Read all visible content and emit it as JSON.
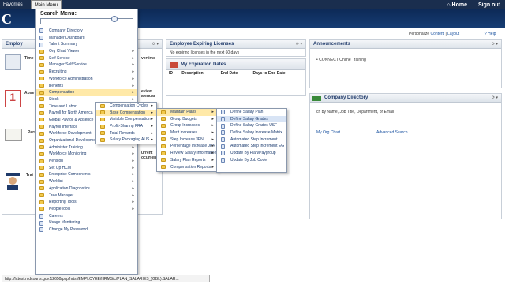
{
  "topbar": {
    "favorites": "Favorites",
    "main_menu": "Main Menu"
  },
  "header": {
    "logo": "C",
    "home": "Home",
    "signout": "Sign out"
  },
  "personalize": {
    "label": "Personalize",
    "content": "Content",
    "sep": "|",
    "layout": "Layout",
    "help": "Help"
  },
  "pagelets": {
    "employee": "Employ",
    "expiring_title": "Employee Expiring Licenses",
    "expiring_msg": "No expiring licenses in the next 60 days",
    "expiration_dates": "My Expiration Dates",
    "exp_cols": [
      "ID",
      "Description",
      "End Date",
      "Days to End Date"
    ],
    "announcements": "Announcements",
    "announce_item": "CONNECT Online Training",
    "company_dir": "Company Directory",
    "dir_hint": "ch by Name, Job Title, Department, or Email",
    "org_chart": "My Org Chart",
    "adv_search": "Advanced Search",
    "time": "Time",
    "absence": "Abse",
    "personal": "Pers",
    "training": "Trai",
    "overtime": "vertime",
    "review": "eview",
    "calendar": "alendar",
    "current": "urrent",
    "documents": "ocuments"
  },
  "menu": {
    "heading": "Search Menu:",
    "items": [
      {
        "label": "Company Directory",
        "type": "page"
      },
      {
        "label": "Manager Dashboard",
        "type": "page"
      },
      {
        "label": "Talent Summary",
        "type": "page"
      },
      {
        "label": "Org Chart Viewer",
        "type": "folder"
      },
      {
        "label": "Self Service",
        "type": "folder"
      },
      {
        "label": "Manager Self Service",
        "type": "folder"
      },
      {
        "label": "Recruiting",
        "type": "folder"
      },
      {
        "label": "Workforce Administration",
        "type": "folder"
      },
      {
        "label": "Benefits",
        "type": "folder"
      },
      {
        "label": "Compensation",
        "type": "folder"
      },
      {
        "label": "Stock",
        "type": "folder"
      },
      {
        "label": "Time and Labor",
        "type": "folder"
      },
      {
        "label": "Payroll for North America",
        "type": "folder"
      },
      {
        "label": "Global Payroll & Absence",
        "type": "folder"
      },
      {
        "label": "Payroll Interface",
        "type": "folder"
      },
      {
        "label": "Workforce Development",
        "type": "folder"
      },
      {
        "label": "Organizational Development",
        "type": "folder"
      },
      {
        "label": "Administer Training",
        "type": "folder"
      },
      {
        "label": "Workforce Monitoring",
        "type": "folder"
      },
      {
        "label": "Pension",
        "type": "folder"
      },
      {
        "label": "Set Up HCM",
        "type": "folder"
      },
      {
        "label": "Enterprise Components",
        "type": "folder"
      },
      {
        "label": "Worklist",
        "type": "folder"
      },
      {
        "label": "Application Diagnostics",
        "type": "folder"
      },
      {
        "label": "Tree Manager",
        "type": "folder"
      },
      {
        "label": "Reporting Tools",
        "type": "folder"
      },
      {
        "label": "PeopleTools",
        "type": "folder"
      },
      {
        "label": "Careers",
        "type": "page"
      },
      {
        "label": "Usage Monitoring",
        "type": "page"
      },
      {
        "label": "Change My Password",
        "type": "page"
      }
    ],
    "comp_items": [
      {
        "label": "Compensation Cycles",
        "type": "folder"
      },
      {
        "label": "Base Compensation",
        "type": "folder"
      },
      {
        "label": "Variable Compensation",
        "type": "folder"
      },
      {
        "label": "Profit-Sharing FRA",
        "type": "folder"
      },
      {
        "label": "Total Rewards",
        "type": "folder"
      },
      {
        "label": "Salary Packaging AUS",
        "type": "folder"
      }
    ],
    "base_items": [
      {
        "label": "Maintain Plans",
        "type": "folder"
      },
      {
        "label": "Group Budgets",
        "type": "folder"
      },
      {
        "label": "Group Increases",
        "type": "folder"
      },
      {
        "label": "Merit Increases",
        "type": "folder"
      },
      {
        "label": "Step Increase JPN",
        "type": "folder"
      },
      {
        "label": "Percentage Increase JPN",
        "type": "folder"
      },
      {
        "label": "Review Salary Information",
        "type": "folder"
      },
      {
        "label": "Salary Plan Reports",
        "type": "folder"
      },
      {
        "label": "Compensation Reports",
        "type": "folder"
      }
    ],
    "plan_items": [
      {
        "label": "Define Salary Plan",
        "type": "page"
      },
      {
        "label": "Define Salary Grades",
        "type": "page"
      },
      {
        "label": "Define Salary Grades USF",
        "type": "page"
      },
      {
        "label": "Define Salary Increase Matrix",
        "type": "page"
      },
      {
        "label": "Automated Step Increment",
        "type": "page"
      },
      {
        "label": "Automated Step Increment EG",
        "type": "page"
      },
      {
        "label": "Update By Plan/Paygroup",
        "type": "page"
      },
      {
        "label": "Update By Job Code",
        "type": "page"
      }
    ]
  },
  "status_url": "http://httest.mdcourts.gov:12650/psp/hrtst/EMPLOYEE/HRMS/c/PLAN_SALARIES_(GBL).SALAR..."
}
